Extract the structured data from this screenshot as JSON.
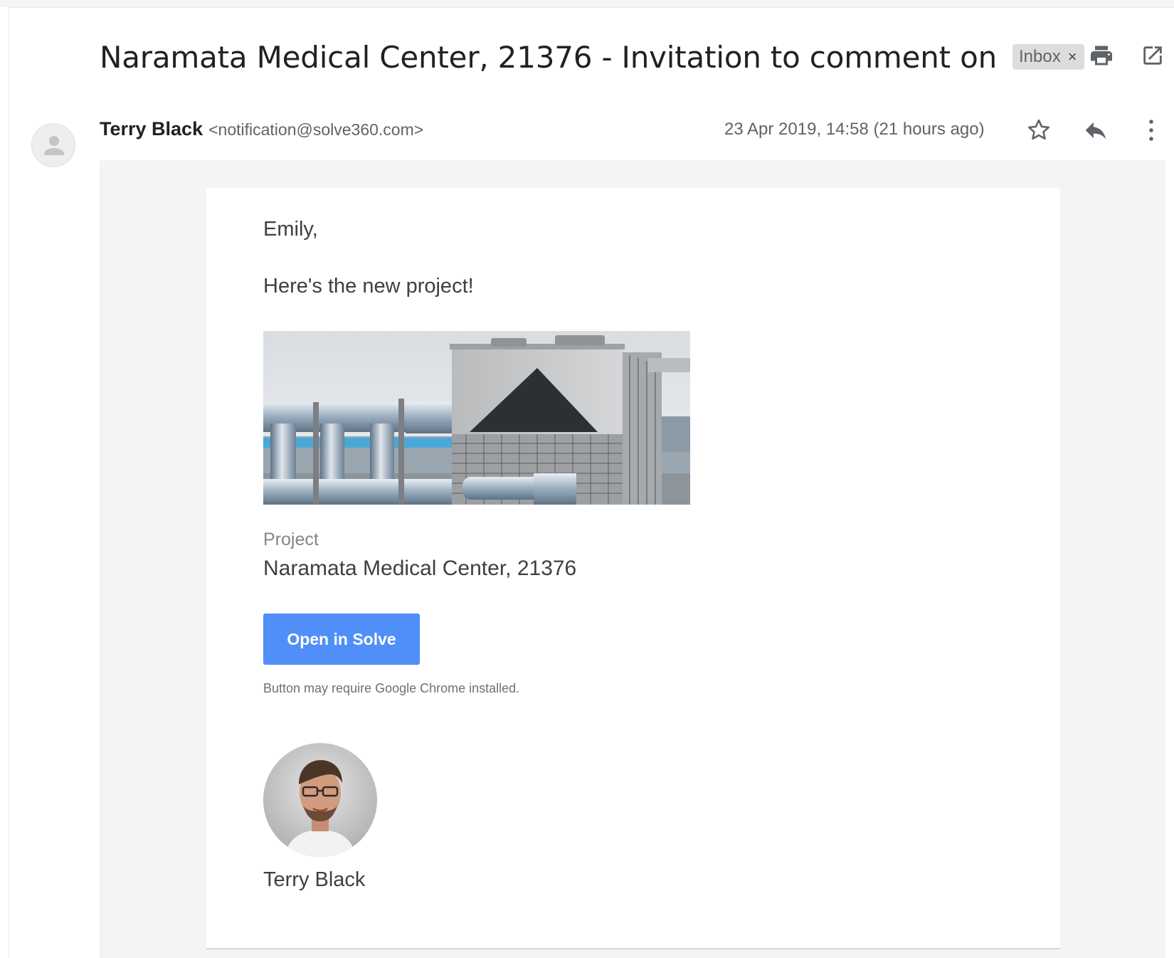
{
  "email": {
    "subject": "Naramata Medical Center, 21376 - Invitation to comment on",
    "label": "Inbox",
    "label_remove": "×",
    "sender_name": "Terry Black",
    "sender_email": "<notification@solve360.com>",
    "date": "23 Apr 2019, 14:58 (21 hours ago)"
  },
  "body": {
    "greeting": "Emily,",
    "intro": "Here's the new project!",
    "project_label": "Project",
    "project_name": "Naramata Medical Center, 21376",
    "button_label": "Open in Solve",
    "note": "Button may require Google Chrome installed.",
    "author_name": "Terry Black"
  },
  "icons": {
    "print": "print-icon",
    "open_new_window": "open-in-new-window-icon",
    "star": "star-icon",
    "reply": "reply-icon",
    "more": "more-vertical-icon",
    "default_avatar": "person-icon"
  },
  "colors": {
    "button": "#4f8ff7",
    "label_chip": "#dddddd",
    "email_background": "#f4f4f4"
  }
}
